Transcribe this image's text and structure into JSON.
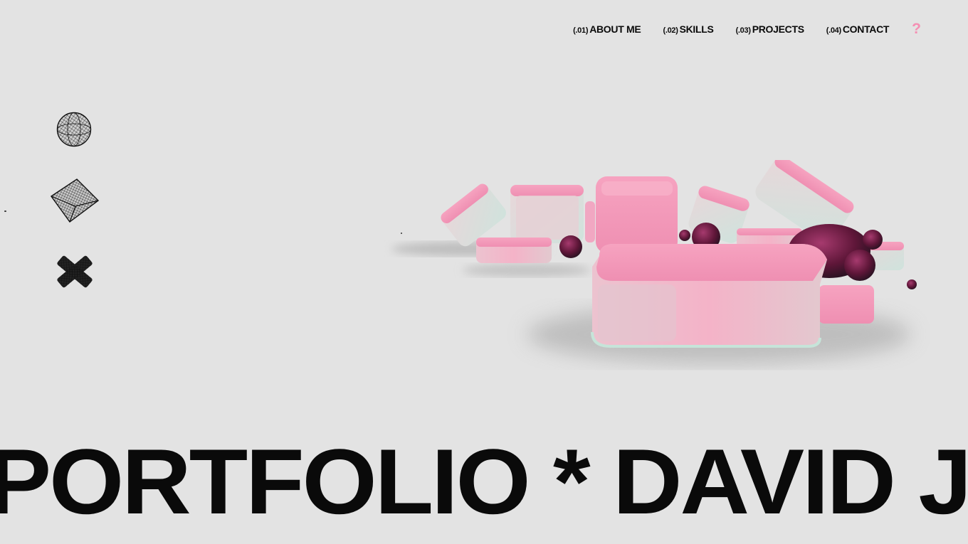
{
  "nav": {
    "items": [
      {
        "num": "(.01)",
        "label": "ABOUT ME"
      },
      {
        "num": "(.02)",
        "label": "SKILLS"
      },
      {
        "num": "(.03)",
        "label": "PROJECTS"
      },
      {
        "num": "(.04)",
        "label": "CONTACT"
      }
    ],
    "help": "?"
  },
  "side_icons": [
    "wireframe-sphere-icon",
    "wireframe-cube-icon",
    "wireframe-cross-icon"
  ],
  "marquee": {
    "text": "PORTFOLIO * DAVID J. B"
  },
  "colors": {
    "background": "#e3e3e3",
    "accent": "#f58fb3",
    "text": "#0a0a0a",
    "blob": "#7a1c4a"
  }
}
